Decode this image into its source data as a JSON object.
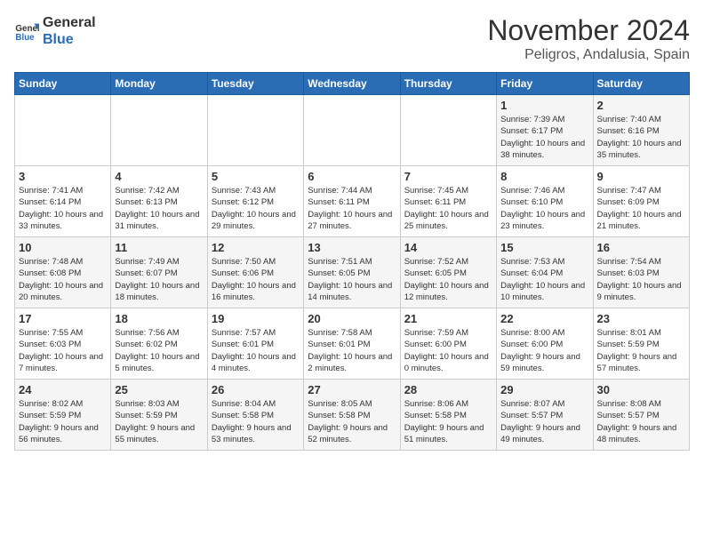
{
  "logo": {
    "line1": "General",
    "line2": "Blue"
  },
  "title": "November 2024",
  "subtitle": "Peligros, Andalusia, Spain",
  "days_of_week": [
    "Sunday",
    "Monday",
    "Tuesday",
    "Wednesday",
    "Thursday",
    "Friday",
    "Saturday"
  ],
  "weeks": [
    [
      {
        "day": "",
        "info": ""
      },
      {
        "day": "",
        "info": ""
      },
      {
        "day": "",
        "info": ""
      },
      {
        "day": "",
        "info": ""
      },
      {
        "day": "",
        "info": ""
      },
      {
        "day": "1",
        "info": "Sunrise: 7:39 AM\nSunset: 6:17 PM\nDaylight: 10 hours and 38 minutes."
      },
      {
        "day": "2",
        "info": "Sunrise: 7:40 AM\nSunset: 6:16 PM\nDaylight: 10 hours and 35 minutes."
      }
    ],
    [
      {
        "day": "3",
        "info": "Sunrise: 7:41 AM\nSunset: 6:14 PM\nDaylight: 10 hours and 33 minutes."
      },
      {
        "day": "4",
        "info": "Sunrise: 7:42 AM\nSunset: 6:13 PM\nDaylight: 10 hours and 31 minutes."
      },
      {
        "day": "5",
        "info": "Sunrise: 7:43 AM\nSunset: 6:12 PM\nDaylight: 10 hours and 29 minutes."
      },
      {
        "day": "6",
        "info": "Sunrise: 7:44 AM\nSunset: 6:11 PM\nDaylight: 10 hours and 27 minutes."
      },
      {
        "day": "7",
        "info": "Sunrise: 7:45 AM\nSunset: 6:11 PM\nDaylight: 10 hours and 25 minutes."
      },
      {
        "day": "8",
        "info": "Sunrise: 7:46 AM\nSunset: 6:10 PM\nDaylight: 10 hours and 23 minutes."
      },
      {
        "day": "9",
        "info": "Sunrise: 7:47 AM\nSunset: 6:09 PM\nDaylight: 10 hours and 21 minutes."
      }
    ],
    [
      {
        "day": "10",
        "info": "Sunrise: 7:48 AM\nSunset: 6:08 PM\nDaylight: 10 hours and 20 minutes."
      },
      {
        "day": "11",
        "info": "Sunrise: 7:49 AM\nSunset: 6:07 PM\nDaylight: 10 hours and 18 minutes."
      },
      {
        "day": "12",
        "info": "Sunrise: 7:50 AM\nSunset: 6:06 PM\nDaylight: 10 hours and 16 minutes."
      },
      {
        "day": "13",
        "info": "Sunrise: 7:51 AM\nSunset: 6:05 PM\nDaylight: 10 hours and 14 minutes."
      },
      {
        "day": "14",
        "info": "Sunrise: 7:52 AM\nSunset: 6:05 PM\nDaylight: 10 hours and 12 minutes."
      },
      {
        "day": "15",
        "info": "Sunrise: 7:53 AM\nSunset: 6:04 PM\nDaylight: 10 hours and 10 minutes."
      },
      {
        "day": "16",
        "info": "Sunrise: 7:54 AM\nSunset: 6:03 PM\nDaylight: 10 hours and 9 minutes."
      }
    ],
    [
      {
        "day": "17",
        "info": "Sunrise: 7:55 AM\nSunset: 6:03 PM\nDaylight: 10 hours and 7 minutes."
      },
      {
        "day": "18",
        "info": "Sunrise: 7:56 AM\nSunset: 6:02 PM\nDaylight: 10 hours and 5 minutes."
      },
      {
        "day": "19",
        "info": "Sunrise: 7:57 AM\nSunset: 6:01 PM\nDaylight: 10 hours and 4 minutes."
      },
      {
        "day": "20",
        "info": "Sunrise: 7:58 AM\nSunset: 6:01 PM\nDaylight: 10 hours and 2 minutes."
      },
      {
        "day": "21",
        "info": "Sunrise: 7:59 AM\nSunset: 6:00 PM\nDaylight: 10 hours and 0 minutes."
      },
      {
        "day": "22",
        "info": "Sunrise: 8:00 AM\nSunset: 6:00 PM\nDaylight: 9 hours and 59 minutes."
      },
      {
        "day": "23",
        "info": "Sunrise: 8:01 AM\nSunset: 5:59 PM\nDaylight: 9 hours and 57 minutes."
      }
    ],
    [
      {
        "day": "24",
        "info": "Sunrise: 8:02 AM\nSunset: 5:59 PM\nDaylight: 9 hours and 56 minutes."
      },
      {
        "day": "25",
        "info": "Sunrise: 8:03 AM\nSunset: 5:59 PM\nDaylight: 9 hours and 55 minutes."
      },
      {
        "day": "26",
        "info": "Sunrise: 8:04 AM\nSunset: 5:58 PM\nDaylight: 9 hours and 53 minutes."
      },
      {
        "day": "27",
        "info": "Sunrise: 8:05 AM\nSunset: 5:58 PM\nDaylight: 9 hours and 52 minutes."
      },
      {
        "day": "28",
        "info": "Sunrise: 8:06 AM\nSunset: 5:58 PM\nDaylight: 9 hours and 51 minutes."
      },
      {
        "day": "29",
        "info": "Sunrise: 8:07 AM\nSunset: 5:57 PM\nDaylight: 9 hours and 49 minutes."
      },
      {
        "day": "30",
        "info": "Sunrise: 8:08 AM\nSunset: 5:57 PM\nDaylight: 9 hours and 48 minutes."
      }
    ]
  ]
}
